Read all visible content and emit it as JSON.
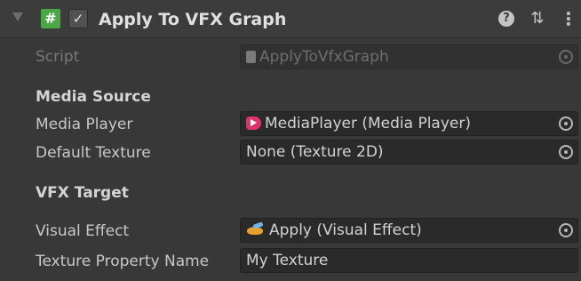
{
  "header": {
    "script_icon_glyph": "#",
    "toggle_glyph": "✓",
    "title": "Apply To VFX Graph",
    "help_glyph": "?",
    "presets_glyph": "⇅",
    "menu_glyph": "⋮"
  },
  "rows": {
    "script": {
      "label": "Script",
      "value": "ApplyToVfxGraph"
    },
    "media_source_heading": "Media Source",
    "media_player": {
      "label": "Media Player",
      "value": "MediaPlayer (Media Player)"
    },
    "default_texture": {
      "label": "Default Texture",
      "value": "None (Texture 2D)"
    },
    "vfx_target_heading": "VFX Target",
    "visual_effect": {
      "label": "Visual Effect",
      "value": "Apply (Visual Effect)"
    },
    "texture_property_name": {
      "label": "Texture Property Name",
      "value": "My Texture"
    }
  },
  "icons": {
    "foldout": "triangle-down-icon",
    "script": "csharp-script-icon",
    "enable": "checkbox-icon",
    "help": "help-icon",
    "presets": "presets-icon",
    "menu": "kebab-menu-icon",
    "media_player": "media-player-icon",
    "visual_effect": "visual-effect-icon",
    "object_picker": "object-picker-icon"
  },
  "colors": {
    "background": "#383838",
    "header": "#3c3c3c",
    "field": "#2a2a2a",
    "script_icon": "#4ba646",
    "media_icon": "#e0336e"
  }
}
